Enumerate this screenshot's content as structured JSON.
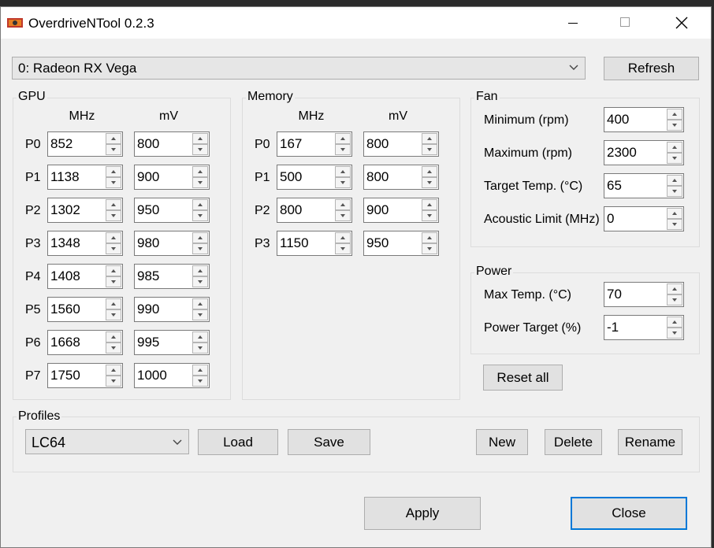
{
  "window": {
    "title": "OverdriveNTool 0.2.3"
  },
  "device": {
    "selected": "0: Radeon RX Vega",
    "refresh_label": "Refresh"
  },
  "gpu": {
    "title": "GPU",
    "mhz_header": "MHz",
    "mv_header": "mV",
    "states": [
      {
        "label": "P0",
        "mhz": "852",
        "mv": "800"
      },
      {
        "label": "P1",
        "mhz": "1138",
        "mv": "900"
      },
      {
        "label": "P2",
        "mhz": "1302",
        "mv": "950"
      },
      {
        "label": "P3",
        "mhz": "1348",
        "mv": "980"
      },
      {
        "label": "P4",
        "mhz": "1408",
        "mv": "985"
      },
      {
        "label": "P5",
        "mhz": "1560",
        "mv": "990"
      },
      {
        "label": "P6",
        "mhz": "1668",
        "mv": "995"
      },
      {
        "label": "P7",
        "mhz": "1750",
        "mv": "1000"
      }
    ]
  },
  "memory": {
    "title": "Memory",
    "mhz_header": "MHz",
    "mv_header": "mV",
    "states": [
      {
        "label": "P0",
        "mhz": "167",
        "mv": "800"
      },
      {
        "label": "P1",
        "mhz": "500",
        "mv": "800"
      },
      {
        "label": "P2",
        "mhz": "800",
        "mv": "900"
      },
      {
        "label": "P3",
        "mhz": "1150",
        "mv": "950"
      }
    ]
  },
  "fan": {
    "title": "Fan",
    "minimum_label": "Minimum (rpm)",
    "minimum": "400",
    "maximum_label": "Maximum (rpm)",
    "maximum": "2300",
    "target_label": "Target Temp. (°C)",
    "target": "65",
    "acoustic_label": "Acoustic Limit (MHz)",
    "acoustic": "0"
  },
  "power": {
    "title": "Power",
    "max_temp_label": "Max Temp. (°C)",
    "max_temp": "70",
    "target_label": "Power Target (%)",
    "target": "-1"
  },
  "reset_all_label": "Reset all",
  "profiles": {
    "title": "Profiles",
    "selected": "LC64",
    "load_label": "Load",
    "save_label": "Save",
    "new_label": "New",
    "delete_label": "Delete",
    "rename_label": "Rename"
  },
  "footer": {
    "apply_label": "Apply",
    "close_label": "Close"
  }
}
